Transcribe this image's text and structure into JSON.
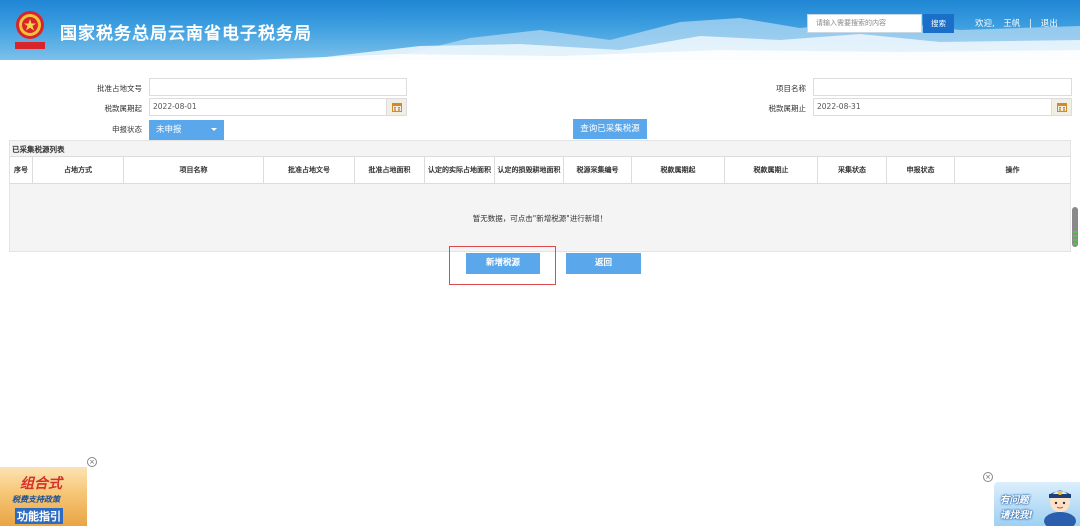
{
  "header": {
    "title": "国家税务总局云南省电子税务局",
    "search_placeholder": "请输入需要搜索的内容",
    "search_button": "搜索",
    "welcome": "欢迎,",
    "user": "王帆",
    "separator": "|",
    "logout": "退出"
  },
  "form": {
    "approval_doc_label": "批准占地文号",
    "approval_doc_value": "",
    "project_name_label": "项目名称",
    "project_name_value": "",
    "period_start_label": "税款属期起",
    "period_start_value": "2022-08-01",
    "period_end_label": "税款属期止",
    "period_end_value": "2022-08-31",
    "status_label": "申报状态",
    "status_value": "未申报",
    "query_button": "查询已采集税源"
  },
  "table": {
    "title": "已采集税源列表",
    "columns": [
      "序号",
      "占地方式",
      "项目名称",
      "批准占地文号",
      "批准占地面积",
      "认定的实际占地面积",
      "认定的损毁耕地面积",
      "税源采集编号",
      "税款属期起",
      "税款属期止",
      "采集状态",
      "申报状态",
      "操作"
    ],
    "empty_message": "暂无数据，可点击\"新增税源\"进行新增！"
  },
  "actions": {
    "add_button": "新增税源",
    "back_button": "返回"
  },
  "promo_left": {
    "line1": "组合式",
    "line2": "税费支持政策",
    "line3": "功能指引",
    "close": "×"
  },
  "promo_right": {
    "line1": "有问题",
    "line2": "请找我!",
    "close": "×"
  },
  "colors": {
    "header_blue": "#1f86d4",
    "button_blue": "#5aa8eb",
    "highlight_red": "#e0484f"
  }
}
